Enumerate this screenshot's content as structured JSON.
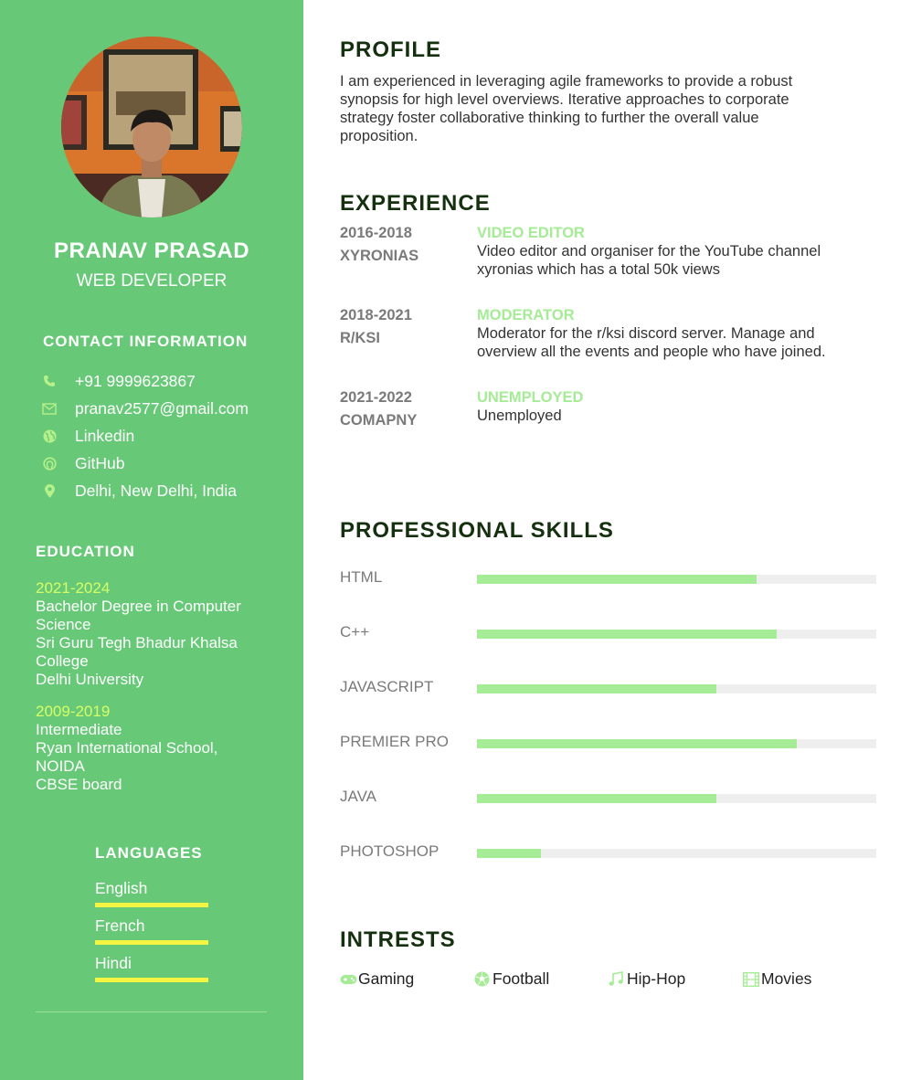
{
  "sidebar": {
    "name": "PRANAV PRASAD",
    "role": "WEB DEVELOPER",
    "contact_heading": "CONTACT INFORMATION",
    "contact": [
      {
        "icon": "phone-icon",
        "text": "+91 9999623867"
      },
      {
        "icon": "mail-icon",
        "text": "pranav2577@gmail.com"
      },
      {
        "icon": "globe-icon",
        "text": "Linkedin"
      },
      {
        "icon": "github-icon",
        "text": "GitHub"
      },
      {
        "icon": "location-pin-icon",
        "text": "Delhi, New Delhi, India"
      }
    ],
    "education_heading": "EDUCATION",
    "education": [
      {
        "years": "2021-2024",
        "lines": [
          "Bachelor Degree in Computer",
          "Science",
          "Sri Guru Tegh Bhadur Khalsa",
          "College",
          "Delhi University"
        ]
      },
      {
        "years": "2009-2019",
        "lines": [
          "Intermediate",
          "Ryan International School,",
          "NOIDA",
          "CBSE board"
        ]
      }
    ],
    "languages_heading": "LANGUAGES",
    "languages": [
      "English",
      "French",
      "Hindi"
    ]
  },
  "profile": {
    "heading": "PROFILE",
    "lines": [
      "I am experienced in leveraging agile frameworks to provide a robust",
      "synopsis for high level overviews. Iterative approaches to corporate",
      "strategy foster collaborative thinking to further the overall value",
      "proposition."
    ]
  },
  "experience": {
    "heading": "EXPERIENCE",
    "items": [
      {
        "years": "2016-2018",
        "company": "XYRONIAS",
        "title": "VIDEO EDITOR",
        "lines": [
          "Video editor and organiser for the YouTube channel",
          "xyronias which has a total 50k views"
        ]
      },
      {
        "years": "2018-2021",
        "company": "R/KSI",
        "title": "MODERATOR",
        "lines": [
          "Moderator for the r/ksi discord server. Manage and",
          "overview all the events and people who have joined."
        ]
      },
      {
        "years": "2021-2022",
        "company": "COMAPNY",
        "title": "UNEMPLOYED",
        "lines": [
          "Unemployed"
        ]
      }
    ]
  },
  "skills": {
    "heading": "PROFESSIONAL SKILLS",
    "items": [
      {
        "label": "HTML",
        "level": 0.7
      },
      {
        "label": "C++",
        "level": 0.75
      },
      {
        "label": "JAVASCRIPT",
        "level": 0.6
      },
      {
        "label": "PREMIER PRO",
        "level": 0.8
      },
      {
        "label": "JAVA",
        "level": 0.6
      },
      {
        "label": "PHOTOSHOP",
        "level": 0.16
      }
    ]
  },
  "interests": {
    "heading": "INTRESTS",
    "items": [
      {
        "icon": "gamepad-icon",
        "label": "Gaming"
      },
      {
        "icon": "football-icon",
        "label": "Football"
      },
      {
        "icon": "music-note-icon",
        "label": "Hip-Hop"
      },
      {
        "icon": "film-icon",
        "label": "Movies"
      }
    ]
  },
  "colors": {
    "sidebar_bg": "#67c977",
    "accent": "#a6eb95",
    "education_years": "#d6ff66",
    "language_bar": "#f4f442",
    "heading": "#15300f"
  }
}
